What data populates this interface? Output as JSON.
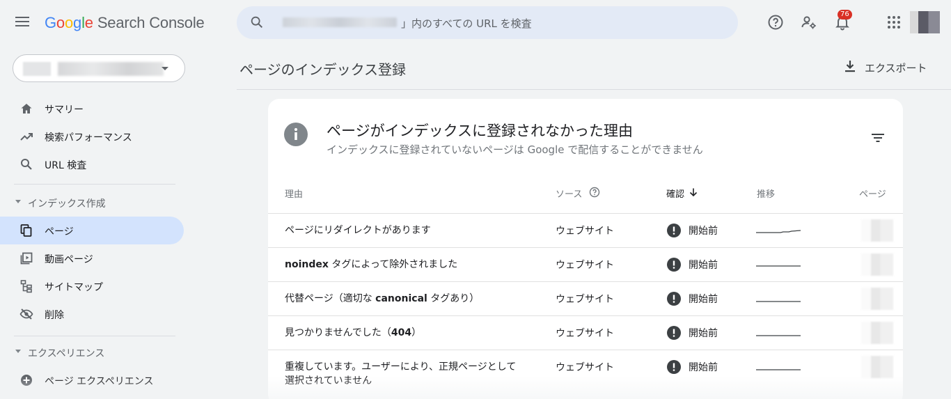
{
  "header": {
    "logo_google": [
      "G",
      "o",
      "o",
      "g",
      "l",
      "e"
    ],
    "logo_product": "Search Console",
    "search_placeholder": "」内のすべての URL を検査",
    "notification_count": "76"
  },
  "sidebar": {
    "items_top": [
      {
        "label": "サマリー",
        "icon": "home-icon"
      },
      {
        "label": "検索パフォーマンス",
        "icon": "trending-up-icon"
      },
      {
        "label": "URL 検査",
        "icon": "search-icon"
      }
    ],
    "section_index": {
      "label": "インデックス作成",
      "items": [
        {
          "label": "ページ",
          "icon": "pages-icon",
          "active": true
        },
        {
          "label": "動画ページ",
          "icon": "video-page-icon"
        },
        {
          "label": "サイトマップ",
          "icon": "sitemap-icon"
        },
        {
          "label": "削除",
          "icon": "removal-icon"
        }
      ]
    },
    "section_experience": {
      "label": "エクスペリエンス",
      "items": [
        {
          "label": "ページ エクスペリエンス",
          "icon": "page-experience-icon"
        }
      ]
    }
  },
  "main": {
    "page_title": "ページのインデックス登録",
    "export_label": "エクスポート",
    "card": {
      "title": "ページがインデックスに登録されなかった理由",
      "subtitle": "インデックスに登録されていないページは Google で配信することができません",
      "columns": {
        "reason": "理由",
        "source": "ソース",
        "validation": "確認",
        "trend": "推移",
        "pages": "ページ"
      },
      "rows": [
        {
          "reason": "ページにリダイレクトがあります",
          "source": "ウェブサイト",
          "status": "開始前"
        },
        {
          "reason_bold": "noindex",
          "reason_rest": " タグによって除外されました",
          "source": "ウェブサイト",
          "status": "開始前"
        },
        {
          "reason_pre": "代替ページ（適切な ",
          "reason_bold": "canonical",
          "reason_post": " タグあり）",
          "source": "ウェブサイト",
          "status": "開始前"
        },
        {
          "reason_pre": "見つかりませんでした（",
          "reason_bold": "404",
          "reason_post": "）",
          "source": "ウェブサイト",
          "status": "開始前"
        },
        {
          "reason_line1": "重複しています。ユーザーにより、正規ページとして",
          "reason_line2": "選択されていません",
          "source": "ウェブサイト",
          "status": "開始前"
        }
      ]
    }
  },
  "colors": {
    "accent_active": "#d3e3fd",
    "search_bg": "#e3eaf6",
    "badge": "#d93025",
    "status_icon": "#3c4043"
  }
}
